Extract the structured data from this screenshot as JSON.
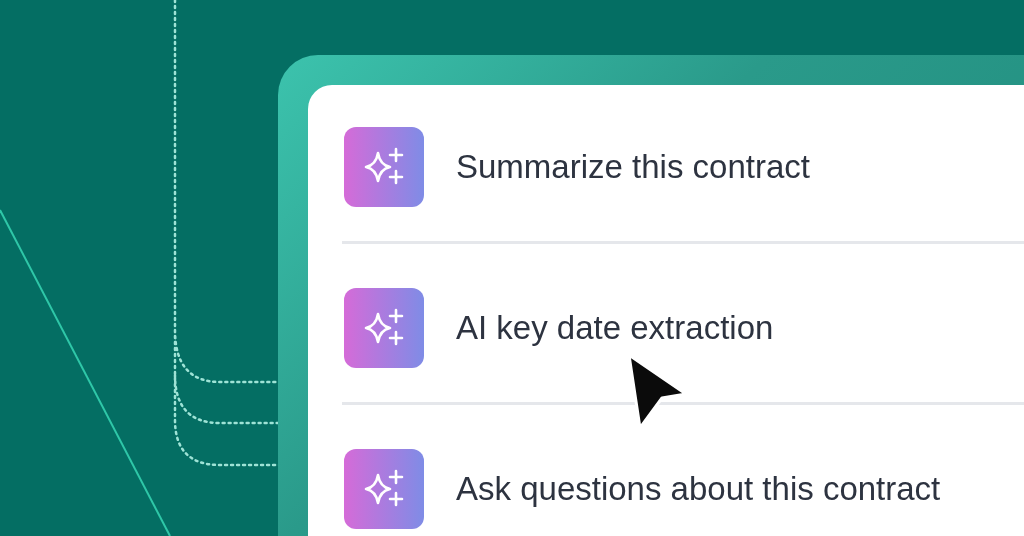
{
  "actions": [
    {
      "label": "Summarize this contract"
    },
    {
      "label": "AI key date extraction"
    },
    {
      "label": "Ask questions about this contract"
    }
  ]
}
